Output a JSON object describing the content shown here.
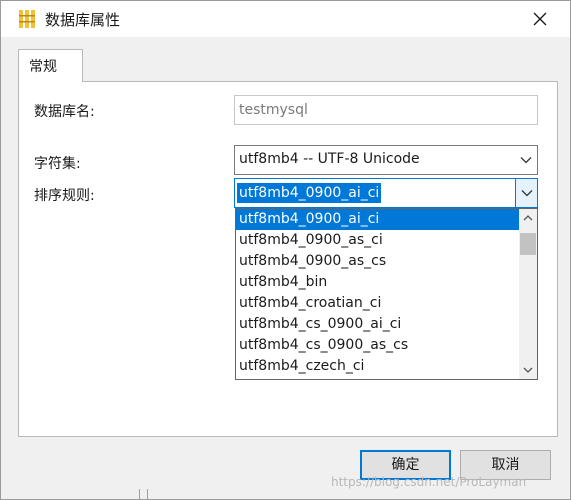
{
  "window": {
    "title": "数据库属性",
    "icon": "database-icon"
  },
  "tabs": [
    {
      "label": "常规",
      "active": true
    }
  ],
  "form": {
    "db_name_label": "数据库名:",
    "db_name_value": "testmysql",
    "charset_label": "字符集:",
    "charset_value": "utf8mb4 -- UTF-8 Unicode",
    "collation_label": "排序规则:",
    "collation_value": "utf8mb4_0900_ai_ci"
  },
  "dropdown": {
    "items": [
      "utf8mb4_0900_ai_ci",
      "utf8mb4_0900_as_ci",
      "utf8mb4_0900_as_cs",
      "utf8mb4_bin",
      "utf8mb4_croatian_ci",
      "utf8mb4_cs_0900_ai_ci",
      "utf8mb4_cs_0900_as_cs",
      "utf8mb4_czech_ci"
    ],
    "selected_index": 0
  },
  "buttons": {
    "ok_label": "确定",
    "cancel_label": "取消"
  },
  "watermark": "https://blog.csdn.net/ProLayman",
  "colors": {
    "accent": "#0078d7",
    "panel": "#ffffff",
    "window_bg": "#f0f0f0",
    "icon_yellow": "#f2c037"
  }
}
